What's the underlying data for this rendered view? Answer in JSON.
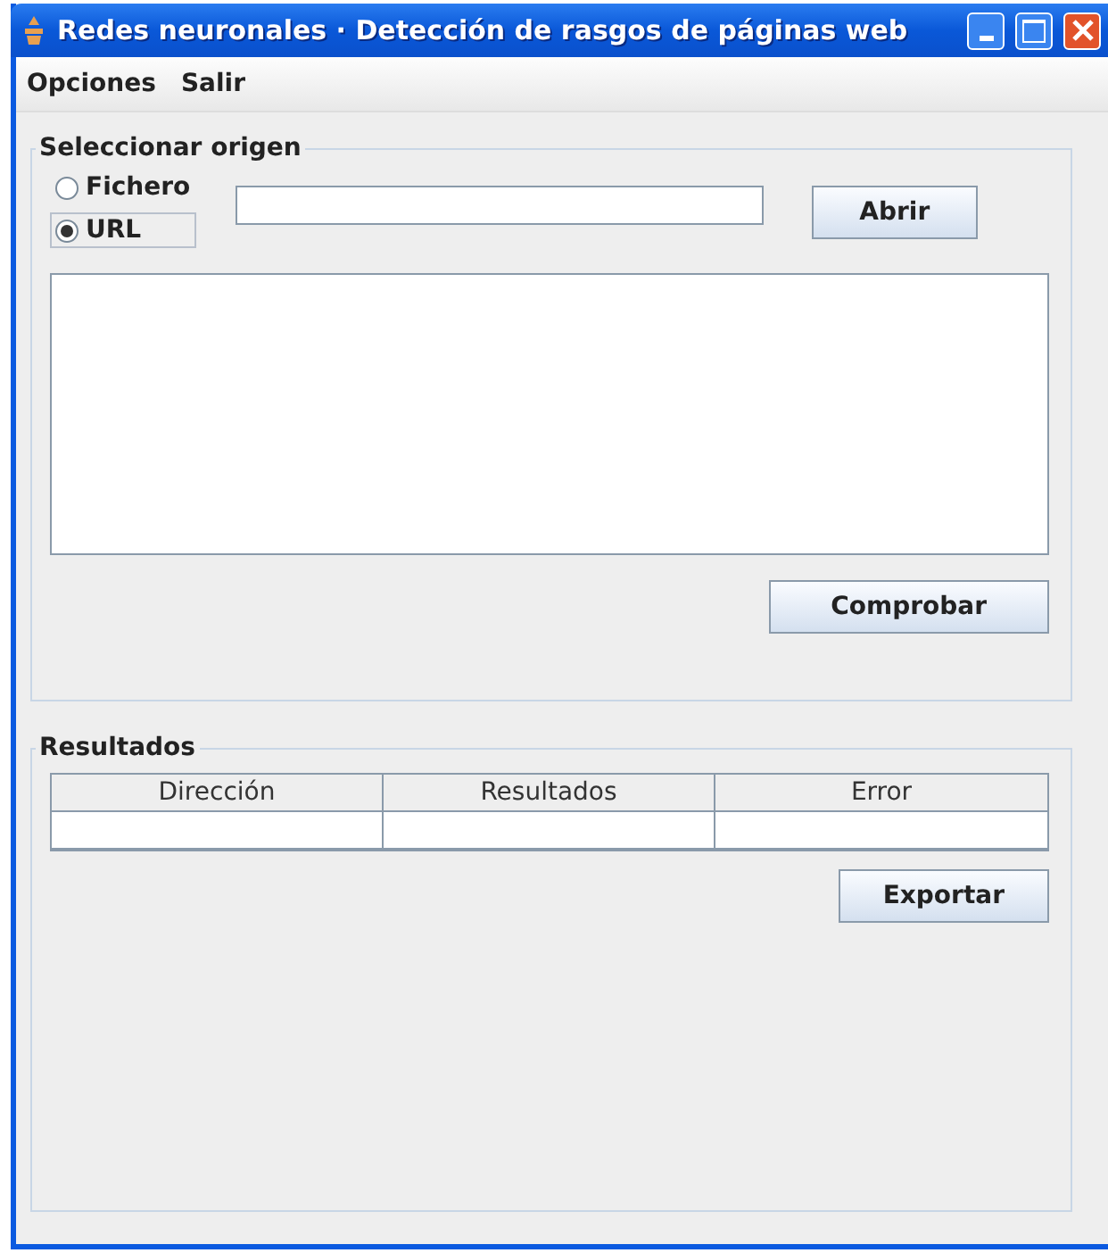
{
  "window": {
    "title": "Redes neuronales · Detección de rasgos de páginas web"
  },
  "menu": [
    "Opciones",
    "Salir"
  ],
  "source": {
    "title": "Seleccionar origen",
    "options": [
      {
        "label": "Fichero",
        "selected": false
      },
      {
        "label": "URL",
        "selected": true
      }
    ],
    "open_button": "Abrir",
    "check_button": "Comprobar"
  },
  "results": {
    "title": "Resultados",
    "columns": [
      "Dirección",
      "Resultados",
      "Error"
    ],
    "export_button": "Exportar"
  }
}
